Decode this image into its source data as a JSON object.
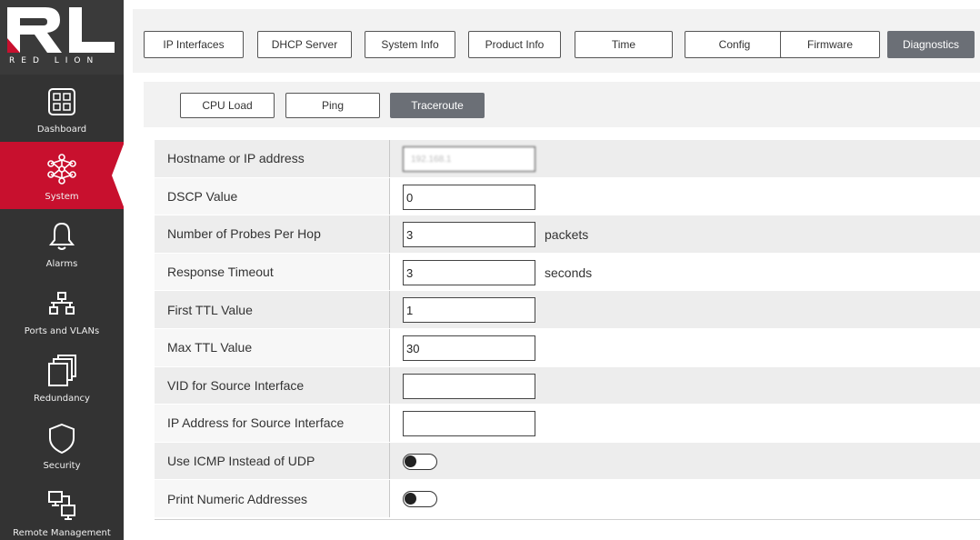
{
  "brand": {
    "name": "RED LION"
  },
  "sidebar": {
    "items": [
      {
        "label": "Dashboard",
        "icon": "dashboard-icon"
      },
      {
        "label": "System",
        "icon": "system-network-icon",
        "active": true
      },
      {
        "label": "Alarms",
        "icon": "bell-icon"
      },
      {
        "label": "Ports and VLANs",
        "icon": "ports-icon"
      },
      {
        "label": "Redundancy",
        "icon": "redundancy-icon"
      },
      {
        "label": "Security",
        "icon": "shield-icon"
      },
      {
        "label": "Remote Management",
        "icon": "remote-management-icon"
      }
    ]
  },
  "tabs": [
    {
      "label": "IP Interfaces"
    },
    {
      "label": "DHCP Server"
    },
    {
      "label": "System Info"
    },
    {
      "label": "Product Info"
    },
    {
      "label": "Time"
    },
    {
      "label": "Config"
    },
    {
      "label": "Firmware"
    },
    {
      "label": "Diagnostics",
      "active": true
    }
  ],
  "subtabs": [
    {
      "label": "CPU Load"
    },
    {
      "label": "Ping"
    },
    {
      "label": "Traceroute",
      "active": true
    }
  ],
  "form": {
    "rows": [
      {
        "label": "Hostname or IP address",
        "value": "192.168.1",
        "unit": ""
      },
      {
        "label": "DSCP Value",
        "value": "0",
        "unit": ""
      },
      {
        "label": "Number of Probes Per Hop",
        "value": "3",
        "unit": "packets"
      },
      {
        "label": "Response Timeout",
        "value": "3",
        "unit": "seconds"
      },
      {
        "label": "First TTL Value",
        "value": "1",
        "unit": ""
      },
      {
        "label": "Max TTL Value",
        "value": "30",
        "unit": ""
      },
      {
        "label": "VID for Source Interface",
        "value": "",
        "unit": ""
      },
      {
        "label": "IP Address for Source Interface",
        "value": "",
        "unit": ""
      },
      {
        "label": "Use ICMP Instead of UDP",
        "toggle": false
      },
      {
        "label": "Print Numeric Addresses",
        "toggle": false
      }
    ]
  },
  "colors": {
    "accent": "#c8102e",
    "sidebar": "#333333",
    "active_tab": "#6b6f76"
  }
}
